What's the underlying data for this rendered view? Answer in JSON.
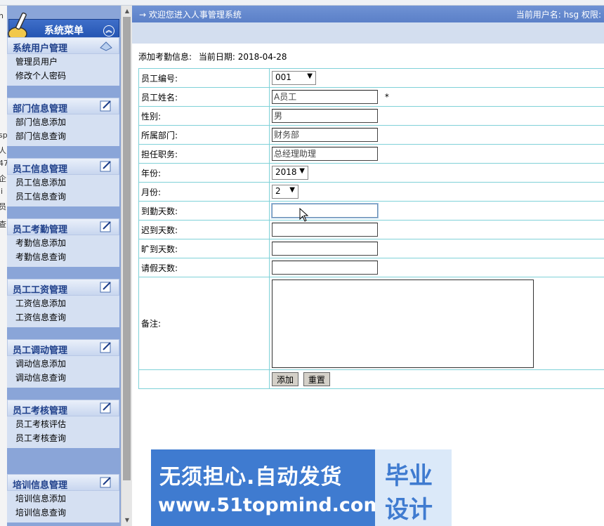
{
  "sidebar": {
    "title": "系统菜单",
    "groups": [
      {
        "title": "系统用户管理",
        "items": [
          "管理员用户",
          "修改个人密码"
        ]
      },
      {
        "title": "部门信息管理",
        "items": [
          "部门信息添加",
          "部门信息查询"
        ]
      },
      {
        "title": "员工信息管理",
        "items": [
          "员工信息添加",
          "员工信息查询"
        ]
      },
      {
        "title": "员工考勤管理",
        "items": [
          "考勤信息添加",
          "考勤信息查询"
        ]
      },
      {
        "title": "员工工资管理",
        "items": [
          "工资信息添加",
          "工资信息查询"
        ]
      },
      {
        "title": "员工调动管理",
        "items": [
          "调动信息添加",
          "调动信息查询"
        ]
      },
      {
        "title": "员工考核管理",
        "items": [
          "员工考核评估",
          "员工考核查询"
        ]
      },
      {
        "title": "培训信息管理",
        "items": [
          "培训信息添加",
          "培训信息查询"
        ]
      }
    ]
  },
  "edge_chars": [
    "h",
    "sp",
    "人",
    "47",
    "企",
    "ji",
    "员",
    "查"
  ],
  "header": {
    "welcome": "→ 欢迎您进入人事管理系统",
    "user": "当前用户名: hsg 权限:"
  },
  "info": {
    "label": "添加考勤信息:",
    "date": "当前日期: 2018-04-28"
  },
  "form": {
    "emp_id": {
      "label": "员工编号:",
      "value": "001"
    },
    "emp_name": {
      "label": "员工姓名:",
      "value": "A员工",
      "required": "*"
    },
    "gender": {
      "label": "性别:",
      "value": "男"
    },
    "dept": {
      "label": "所属部门:",
      "value": "财务部"
    },
    "position": {
      "label": "担任职务:",
      "value": "总经理助理"
    },
    "year": {
      "label": "年份:",
      "value": "2018"
    },
    "month": {
      "label": "月份:",
      "value": "2"
    },
    "attend": {
      "label": "到勤天数:",
      "value": ""
    },
    "late": {
      "label": "迟到天数:",
      "value": ""
    },
    "absent": {
      "label": "旷到天数:",
      "value": ""
    },
    "leave": {
      "label": "请假天数:",
      "value": ""
    },
    "remark": {
      "label": "备注:",
      "value": ""
    },
    "add_button": "添加",
    "reset_button": "重置"
  },
  "banner": {
    "line1": "无须担心.自动发货",
    "line2": "www.51topmind.com",
    "right1": "毕业",
    "right2": "设计"
  },
  "colors": {
    "menu_title": "#2a5cbf",
    "sidebar_bg": "#8aa5d8",
    "border": "#7fd1d8",
    "banner": "#3f7bd0"
  }
}
